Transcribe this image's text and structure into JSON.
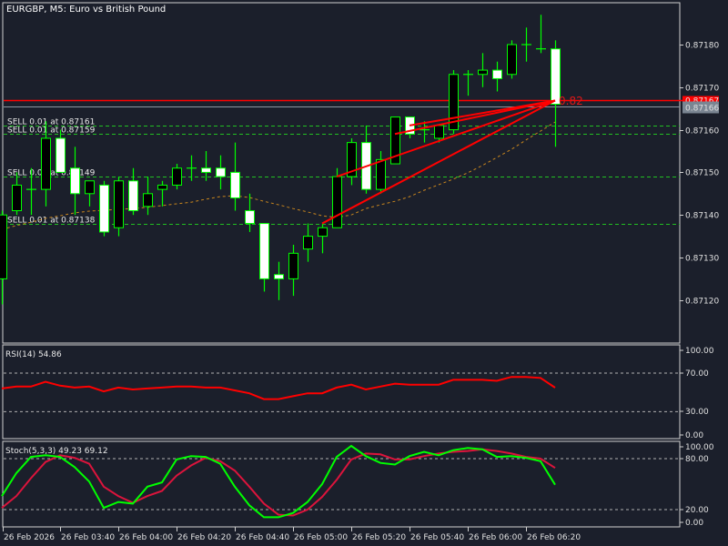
{
  "chart_title": "EURGBP, M5:  Euro vs British Pound",
  "colors": {
    "background": "#1b1f2b",
    "candle_border": "#00ff00",
    "bull_body": "#000000",
    "bear_body": "#ffffff",
    "sell_line": "#22c022",
    "ask_line": "#ff0000",
    "bid_line": "#8c96a0",
    "trade_lines": "#ff0000",
    "moving_average": "#c8861e",
    "rsi_line": "#ff0000",
    "stoch_main": "#00ff00",
    "stoch_signal": "#dc143c"
  },
  "chart_data": [
    {
      "type": "candlestick",
      "symbol": "EURGBP",
      "timeframe": "M5",
      "ylim": [
        0.87115,
        0.87195
      ],
      "price_ticks": [
        "0.87180",
        "0.87170",
        "0.87160",
        "0.87150",
        "0.87140",
        "0.87130",
        "0.87120"
      ],
      "time_labels": [
        "26 Feb 2026",
        "26 Feb 03:40",
        "26 Feb 04:00",
        "26 Feb 04:20",
        "26 Feb 04:40",
        "26 Feb 05:00",
        "26 Feb 05:20",
        "26 Feb 05:40",
        "26 Feb 06:00",
        "26 Feb 06:20"
      ],
      "candles": [
        [
          0.87125,
          0.87141,
          0.87119,
          0.8714
        ],
        [
          0.87141,
          0.8715,
          0.8714,
          0.87147
        ],
        [
          0.87146,
          0.87151,
          0.8714,
          0.87146
        ],
        [
          0.87146,
          0.87162,
          0.87142,
          0.87158
        ],
        [
          0.87158,
          0.8716,
          0.8715,
          0.8715
        ],
        [
          0.87151,
          0.87156,
          0.8714,
          0.87145
        ],
        [
          0.87145,
          0.87148,
          0.87142,
          0.87148
        ],
        [
          0.87147,
          0.87148,
          0.87135,
          0.87136
        ],
        [
          0.87137,
          0.87149,
          0.87135,
          0.87148
        ],
        [
          0.87148,
          0.87151,
          0.8714,
          0.87141
        ],
        [
          0.87142,
          0.87149,
          0.8714,
          0.87145
        ],
        [
          0.87146,
          0.87148,
          0.87142,
          0.87147
        ],
        [
          0.87147,
          0.87152,
          0.87146,
          0.87151
        ],
        [
          0.87151,
          0.87154,
          0.87148,
          0.87151
        ],
        [
          0.87151,
          0.87155,
          0.87148,
          0.8715
        ],
        [
          0.87151,
          0.87154,
          0.87146,
          0.87149
        ],
        [
          0.8715,
          0.87157,
          0.87141,
          0.87144
        ],
        [
          0.87141,
          0.87145,
          0.87136,
          0.87138
        ],
        [
          0.87138,
          0.87138,
          0.87122,
          0.87125
        ],
        [
          0.87126,
          0.87129,
          0.8712,
          0.87125
        ],
        [
          0.87125,
          0.87133,
          0.87121,
          0.87131
        ],
        [
          0.87132,
          0.87138,
          0.87129,
          0.87135
        ],
        [
          0.87135,
          0.87138,
          0.87131,
          0.87137
        ],
        [
          0.87137,
          0.87151,
          0.87137,
          0.87149
        ],
        [
          0.87149,
          0.87158,
          0.87147,
          0.87157
        ],
        [
          0.87157,
          0.87161,
          0.87145,
          0.87146
        ],
        [
          0.87146,
          0.87155,
          0.87145,
          0.87153
        ],
        [
          0.87152,
          0.87163,
          0.87152,
          0.87163
        ],
        [
          0.87163,
          0.87163,
          0.87158,
          0.87159
        ],
        [
          0.8716,
          0.87162,
          0.87157,
          0.8716
        ],
        [
          0.87158,
          0.87161,
          0.87157,
          0.87161
        ],
        [
          0.8716,
          0.87174,
          0.87159,
          0.87173
        ],
        [
          0.87173,
          0.87174,
          0.87168,
          0.87173
        ],
        [
          0.87173,
          0.87178,
          0.8717,
          0.87174
        ],
        [
          0.87174,
          0.87176,
          0.87169,
          0.87172
        ],
        [
          0.87173,
          0.87181,
          0.87172,
          0.8718
        ],
        [
          0.8718,
          0.87184,
          0.87176,
          0.8718
        ],
        [
          0.87179,
          0.87187,
          0.87178,
          0.87179
        ],
        [
          0.87179,
          0.87181,
          0.87156,
          0.87166
        ]
      ],
      "candle_format": [
        "open",
        "high",
        "low",
        "close"
      ],
      "moving_average": [
        0.871366,
        0.871375,
        0.871383,
        0.871392,
        0.871398,
        0.871405,
        0.871409,
        0.871411,
        0.871413,
        0.871415,
        0.871418,
        0.871422,
        0.871426,
        0.87143,
        0.871437,
        0.871443,
        0.871445,
        0.871441,
        0.871432,
        0.871424,
        0.871415,
        0.871407,
        0.871398,
        0.871394,
        0.8714,
        0.871415,
        0.871424,
        0.871432,
        0.871443,
        0.871458,
        0.871471,
        0.871484,
        0.871499,
        0.871516,
        0.871535,
        0.871554,
        0.871576,
        0.871597,
        0.871618
      ],
      "ask_price": "0.87167",
      "bid_price": "0.87166",
      "profit_label": "0.82",
      "orders": [
        {
          "label": "SELL 0.01 at 0.87161",
          "price": 0.87161,
          "entry_candle": 28
        },
        {
          "label": "SELL 0.01 at 0.87159",
          "price": 0.87159,
          "entry_candle": 27
        },
        {
          "label": "SELL 0.01 at 0.87149",
          "price": 0.87149,
          "entry_candle": 23
        },
        {
          "label": "SELL 0.01 at 0.87138",
          "price": 0.87138,
          "entry_candle": 22
        }
      ]
    },
    {
      "type": "line",
      "label": "RSI(14) 54.86",
      "ylim": [
        0,
        100
      ],
      "levels": [
        70,
        30
      ],
      "ticks": [
        "100.00",
        "70.00",
        "30.00",
        "0.00"
      ],
      "values": [
        54,
        56,
        56,
        61,
        57,
        55,
        56,
        51,
        55,
        53,
        54,
        55,
        56,
        56,
        55,
        55,
        52,
        49,
        43,
        43,
        46,
        49,
        49,
        55,
        58,
        53,
        56,
        59,
        58,
        58,
        58,
        63,
        63,
        63,
        62,
        66,
        66,
        65,
        54.86
      ]
    },
    {
      "type": "line",
      "label": "Stoch(5,3,3) 49.23 69.12",
      "ylim": [
        0,
        100
      ],
      "levels": [
        80,
        20
      ],
      "ticks": [
        "100.00",
        "80.00",
        "20.00",
        "0.00"
      ],
      "series": [
        {
          "values": [
            36,
            63,
            82,
            84,
            82,
            70,
            53,
            22,
            29,
            27,
            47,
            52,
            79,
            83,
            82,
            74,
            47,
            25,
            11,
            11,
            16,
            29,
            50,
            82,
            95,
            83,
            75,
            73,
            83,
            88,
            84,
            90,
            92.5,
            91,
            82,
            83,
            81,
            77,
            49.23
          ]
        },
        {
          "values": [
            22,
            36,
            57,
            76,
            84,
            81,
            74,
            47,
            36,
            28,
            36,
            42,
            60,
            72,
            81,
            77,
            66,
            47,
            27,
            14,
            13,
            20,
            35,
            55,
            79,
            86,
            85,
            79,
            79,
            83,
            86,
            88,
            89,
            91,
            89,
            86,
            82,
            80,
            69.12
          ]
        }
      ]
    }
  ]
}
